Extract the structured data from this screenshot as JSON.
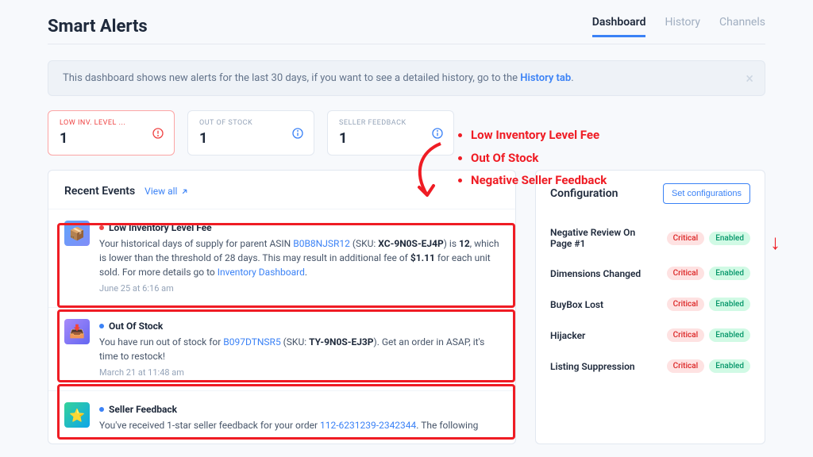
{
  "header": {
    "title": "Smart Alerts",
    "tabs": [
      "Dashboard",
      "History",
      "Channels"
    ],
    "active_tab": "Dashboard"
  },
  "banner": {
    "text_before": "This dashboard shows new alerts for the last 30 days, if you want to see a detailed history, go to the ",
    "link_text": "History tab",
    "text_after": "."
  },
  "stats": [
    {
      "label": "LOW INV. LEVEL ...",
      "value": "1",
      "color": "red"
    },
    {
      "label": "OUT OF STOCK",
      "value": "1",
      "color": "blue"
    },
    {
      "label": "SELLER FEEDBACK",
      "value": "1",
      "color": "blue"
    }
  ],
  "recent": {
    "title": "Recent Events",
    "view_all": "View all",
    "events": [
      {
        "dot": "red",
        "title": "Low Inventory Level Fee",
        "line1_a": "Your historical days of supply for parent ASIN ",
        "asin": "B0B8NJSR12",
        "line1_b": " (SKU: ",
        "sku": "XC-9N0S-EJ4P",
        "line1_c": ") is ",
        "days": "12",
        "line1_d": ", which is lower than the threshold of 28 days. This may result in additional fee of ",
        "fee": "$1.11",
        "line1_e": " for each unit sold. For more details go to ",
        "dash_link": "Inventory Dashboard",
        "line1_f": ".",
        "time": "June 25 at 6:16 am"
      },
      {
        "dot": "blue",
        "title": "Out Of Stock",
        "line1_a": "You have run out of stock for ",
        "asin": "B097DTNSR5",
        "line1_b": " (SKU: ",
        "sku": "TY-9N0S-EJ3P",
        "line1_c": "). Get an order in ASAP, it's time to restock!",
        "time": "March 21 at 11:48 am"
      },
      {
        "dot": "blue",
        "title": "Seller Feedback",
        "line1_a": "You've received 1-star seller feedback for your order ",
        "order": "112-6231239-2342344",
        "line1_b": ". The following"
      }
    ]
  },
  "config": {
    "title": "Configuration",
    "button": "Set configurations",
    "rows": [
      {
        "name": "Negative Review On Page #1",
        "crit": "Critical",
        "enab": "Enabled"
      },
      {
        "name": "Dimensions Changed",
        "crit": "Critical",
        "enab": "Enabled"
      },
      {
        "name": "BuyBox Lost",
        "crit": "Critical",
        "enab": "Enabled"
      },
      {
        "name": "Hijacker",
        "crit": "Critical",
        "enab": "Enabled"
      },
      {
        "name": "Listing Suppression",
        "crit": "Critical",
        "enab": "Enabled"
      }
    ]
  },
  "annotations": {
    "bullets": [
      "Low Inventory Level Fee",
      "Out Of Stock",
      "Negative Seller Feedback"
    ]
  }
}
